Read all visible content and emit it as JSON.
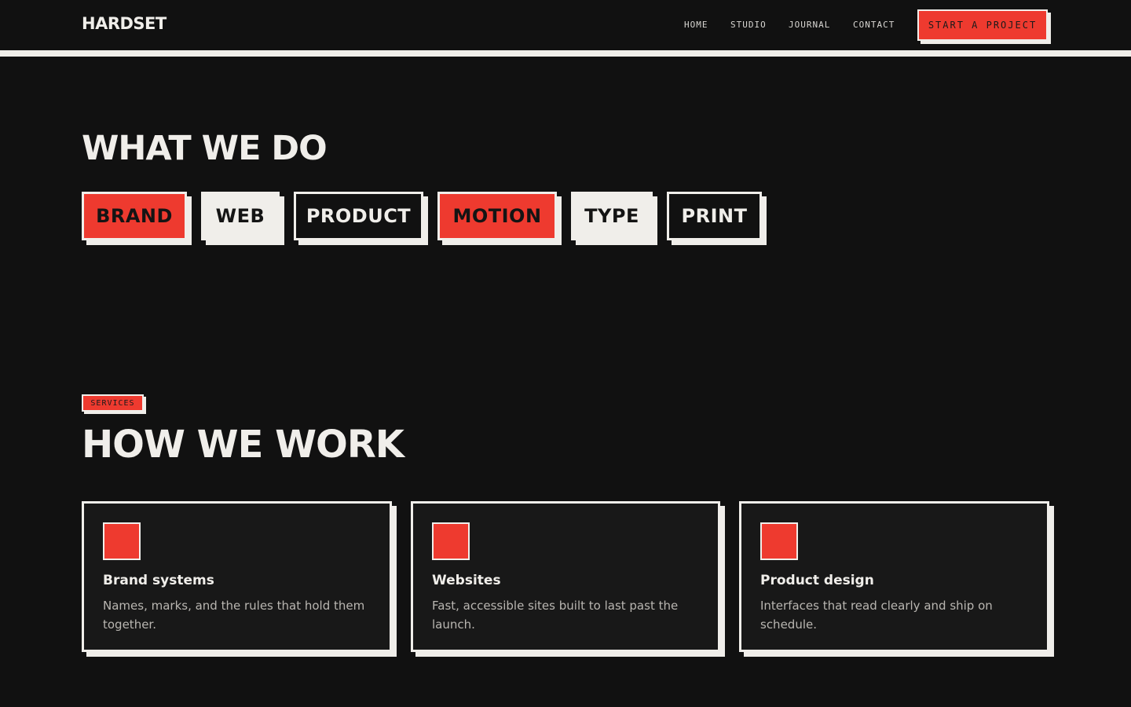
{
  "header": {
    "logo": "HARDSET",
    "nav": [
      {
        "label": "HOME"
      },
      {
        "label": "STUDIO"
      },
      {
        "label": "JOURNAL"
      },
      {
        "label": "CONTACT"
      }
    ],
    "cta_label": "START A PROJECT"
  },
  "what_we_do": {
    "title": "WHAT WE DO",
    "tags": [
      {
        "label": "BRAND",
        "style": "red"
      },
      {
        "label": "WEB",
        "style": "white"
      },
      {
        "label": "PRODUCT",
        "style": "dark"
      },
      {
        "label": "MOTION",
        "style": "red"
      },
      {
        "label": "TYPE",
        "style": "white"
      },
      {
        "label": "PRINT",
        "style": "dark"
      }
    ]
  },
  "services": {
    "badge": "SERVICES",
    "title": "HOW WE WORK",
    "cards": [
      {
        "title": "Brand systems",
        "desc": "Names, marks, and the rules that hold them together."
      },
      {
        "title": "Websites",
        "desc": "Fast, accessible sites built to last past the launch."
      },
      {
        "title": "Product design",
        "desc": "Interfaces that read clearly and ship on schedule."
      }
    ]
  },
  "colors": {
    "background": "#111111",
    "accent": "#ee3a2f",
    "ink": "#f0eeea",
    "card": "#181818"
  }
}
